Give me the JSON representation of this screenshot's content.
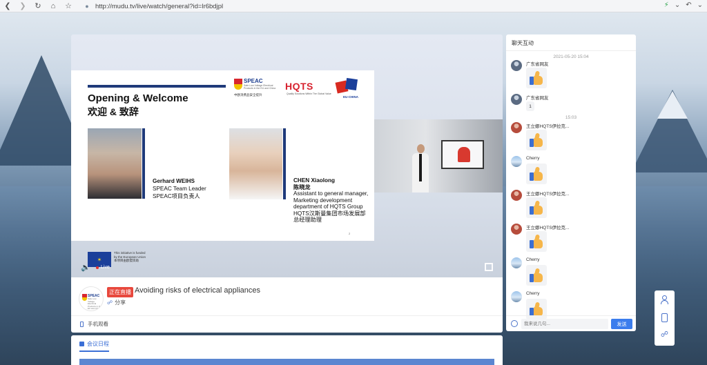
{
  "browser": {
    "url": "http://mudu.tv/live/watch/general?id=lr6bdjpl"
  },
  "video": {
    "slide": {
      "title": "Opening & Welcome",
      "title_cn": "欢迎 & 致辞",
      "logo_speac": "SPEAC",
      "logo_speac_sub": "Safe Low Voltage Electrical Products in the EU and China",
      "logo_speac_cn": "中欧消费品安全提升",
      "logo_hqts": "HQTS",
      "logo_hqts_sub": "Quality Solutions Within The Global Value",
      "logo_flag_text": "EU-CHINA",
      "person1": {
        "name": "Gerhard WEIHS",
        "role": "SPEAC Team Leader",
        "role_cn": "SPEAC项目负责人"
      },
      "person2": {
        "name": "CHEN Xiaolong",
        "name_cn": "陈晓龙",
        "role": "Assistant to general manager, Marketing development department of HQTS Group",
        "role_cn": "HQTS汉斯曼集团市场发展部总经理助理"
      },
      "eu_text_1": "This initiative is funded",
      "eu_text_2": "by the European Union",
      "eu_text_3": "本项目由欧盟资助",
      "page": "2"
    },
    "live_label": "Live"
  },
  "info": {
    "live_badge": "正在直播",
    "title": "Avoiding risks of electrical appliances",
    "share_label": "分享",
    "org_logo_name": "SPEAC",
    "mobile_watch_label": "手机观看"
  },
  "agenda": {
    "tab_label": "会议日程"
  },
  "chat": {
    "header": "聊天互动",
    "input_placeholder": "我来说几句...",
    "send_label": "发送",
    "times": [
      "2021-05-20 15:04",
      "15:03"
    ],
    "messages": [
      {
        "sender": "广东省网友",
        "type": "thumb",
        "avatar": "blue"
      },
      {
        "sender": "广东省网友",
        "type": "text",
        "text": "1",
        "avatar": "blue"
      },
      {
        "sender": "王立娜HQTS伊拉克...",
        "type": "thumb",
        "avatar": "red"
      },
      {
        "sender": "Cherry",
        "type": "thumb",
        "avatar": "sky"
      },
      {
        "sender": "王立娜HQTS伊拉克...",
        "type": "thumb",
        "avatar": "red"
      },
      {
        "sender": "王立娜HQTS伊拉克...",
        "type": "thumb",
        "avatar": "red"
      },
      {
        "sender": "Cherry",
        "type": "thumb",
        "avatar": "sky"
      },
      {
        "sender": "Cherry",
        "type": "thumb",
        "avatar": "sky"
      }
    ]
  },
  "icons": {
    "back": "back-arrow-icon",
    "forward": "forward-arrow-icon",
    "reload": "reload-icon",
    "home": "home-icon",
    "bookmark": "star-icon",
    "volume": "volume-icon",
    "fullscreen": "fullscreen-icon",
    "share": "share-icon",
    "user": "user-icon",
    "mobile": "mobile-icon",
    "emoji": "emoji-icon"
  },
  "colors": {
    "accent": "#3b7ded",
    "live_badge": "#e8483d",
    "slide_bar": "#1f3a7a",
    "hqts_red": "#d7212e"
  }
}
